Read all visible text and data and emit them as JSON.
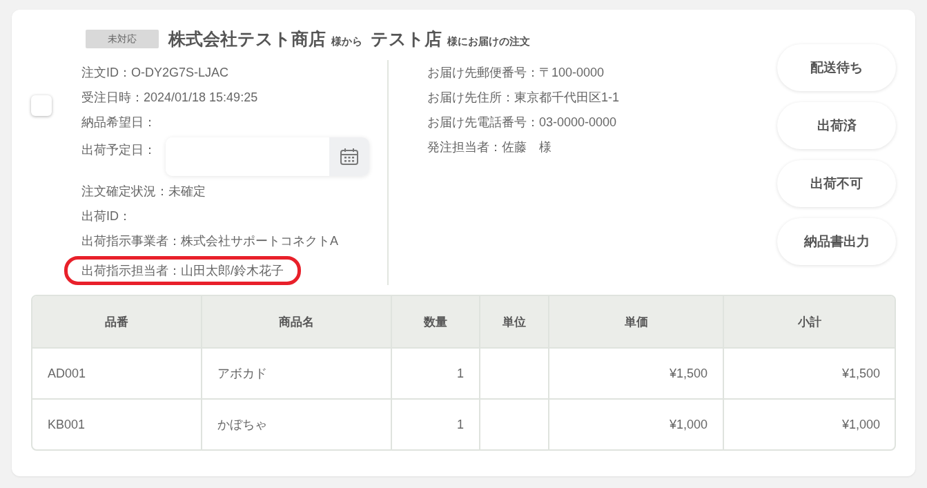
{
  "order": {
    "status_badge": "未対応",
    "shipper": "株式会社テスト商店",
    "shipper_suffix": "様から",
    "recipient": "テスト店",
    "recipient_suffix": "様にお届けの注文",
    "checked": false
  },
  "details_left": [
    {
      "kind": "text",
      "text": "注文ID：O-DY2G7S-LJAC",
      "highlighted": false
    },
    {
      "kind": "text",
      "text": "受注日時：2024/01/18 15:49:25",
      "highlighted": false
    },
    {
      "kind": "text",
      "text": "納品希望日：",
      "highlighted": false
    },
    {
      "kind": "date_field",
      "label": "出荷予定日："
    },
    {
      "kind": "text",
      "text": "注文確定状況：未確定",
      "highlighted": false
    },
    {
      "kind": "text",
      "text": "出荷ID：",
      "highlighted": false
    },
    {
      "kind": "text",
      "text": "出荷指示事業者：株式会社サポートコネクトA",
      "highlighted": false
    },
    {
      "kind": "text",
      "text": "出荷指示担当者：山田太郎/鈴木花子",
      "highlighted": true
    }
  ],
  "details_right": [
    "お届け先郵便番号：〒100-0000",
    "お届け先住所：東京都千代田区1-1",
    "お届け先電話番号：03-0000-0000",
    "発注担当者：佐藤　様"
  ],
  "actions": [
    "配送待ち",
    "出荷済",
    "出荷不可",
    "納品書出力"
  ],
  "table": {
    "columns": [
      "品番",
      "商品名",
      "数量",
      "単位",
      "単価",
      "小計"
    ],
    "rows": [
      [
        "AD001",
        "アボカド",
        "1",
        "",
        "¥1,500",
        "¥1,500"
      ],
      [
        "KB001",
        "かぼちゃ",
        "1",
        "",
        "¥1,000",
        "¥1,000"
      ]
    ]
  }
}
